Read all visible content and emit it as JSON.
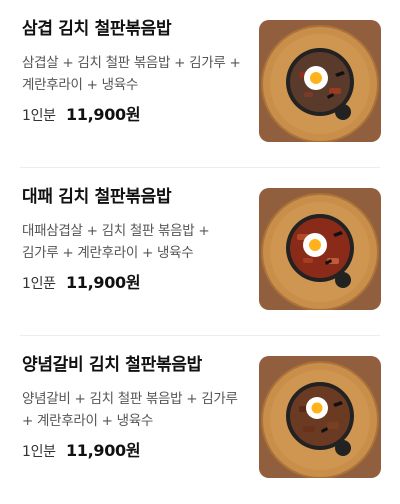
{
  "menu_items": [
    {
      "name": "삼겹 김치 철판볶음밥",
      "description": "삼겹살 + 김치 철판 볶음밥 + 김가루 + 계란후라이 + 냉육수",
      "portion": "1인분",
      "price": "11,900원"
    },
    {
      "name": "대패 김치 철판볶음밥",
      "description": "대패삼겹살 + 김치 철판 볶음밥 + 김가루 + 계란후라이 + 냉육수",
      "portion": "1인푼",
      "price": "11,900원"
    },
    {
      "name": "양념갈비 김치 철판볶음밥",
      "description": "양념갈비 + 김치 철판 볶음밥 + 김가루 + 계란후라이 + 냉육수",
      "portion": "1인분",
      "price": "11,900원"
    }
  ],
  "colors": {
    "table_wood": "#8a5a3b",
    "board": "#c98f4a",
    "skillet": "#222222"
  }
}
